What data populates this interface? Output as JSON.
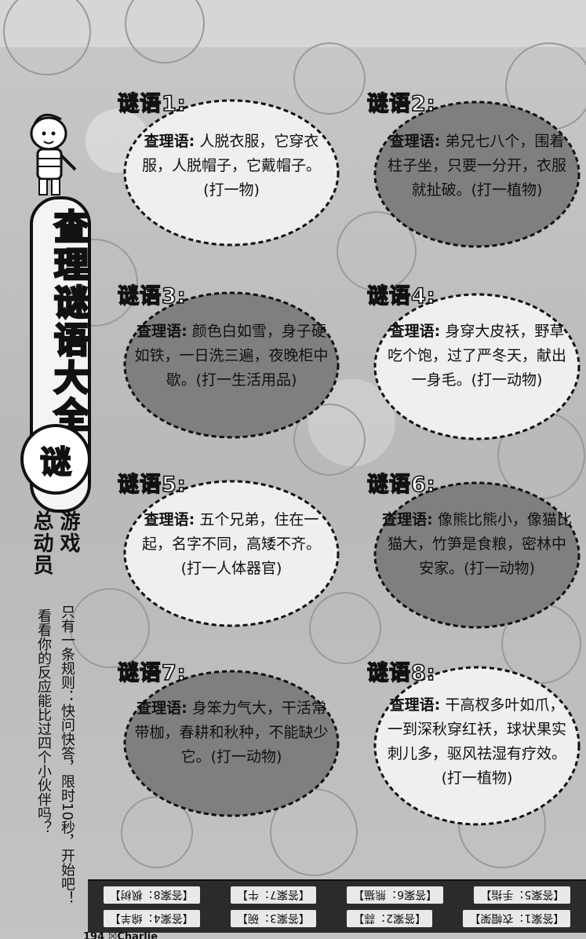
{
  "header": {
    "title_vertical": "查理谜语大全",
    "badge": "谜"
  },
  "sidebar": {
    "game_line1": "游戏",
    "game_line2": "总动员",
    "rules_line1": "只有一条规则：快问快答，限时10秒，开始吧！",
    "rules_line2": "看看你的反应能比过四个小伙伴吗？"
  },
  "riddles": [
    {
      "label": "谜语1:",
      "prefix": "查理语:",
      "text": "人脱衣服，它穿衣服，人脱帽子，它戴帽子。(打一物)"
    },
    {
      "label": "谜语2:",
      "prefix": "查理语:",
      "text": "弟兄七八个，围着柱子坐，只要一分开，衣服就扯破。(打一植物)"
    },
    {
      "label": "谜语3:",
      "prefix": "查理语:",
      "text": "颜色白如雪，身子硬如铁，一日洗三遍，夜晚柜中歇。(打一生活用品)"
    },
    {
      "label": "谜语4:",
      "prefix": "查理语:",
      "text": "身穿大皮袄，野草吃个饱，过了严冬天，献出一身毛。(打一动物)"
    },
    {
      "label": "谜语5:",
      "prefix": "查理语:",
      "text": "五个兄弟，住在一起，名字不同，高矮不齐。(打一人体器官)"
    },
    {
      "label": "谜语6:",
      "prefix": "查理语:",
      "text": "像熊比熊小，像猫比猫大，竹笋是食粮，密林中安家。(打一动物)"
    },
    {
      "label": "谜语7:",
      "prefix": "查理语:",
      "text": "身笨力气大，干活常带枷，春耕和秋种，不能缺少它。(打一动物)"
    },
    {
      "label": "谜语8:",
      "prefix": "查理语:",
      "text": "干高杈多叶如爪，一到深秋穿红袄，球状果实刺儿多，驱风祛湿有疗效。(打一植物)"
    }
  ],
  "answers": {
    "row1": [
      "【答案5：手指】",
      "【答案6：熊猫】",
      "【答案7：牛】",
      "【答案8：枫树】"
    ],
    "row2": [
      "【答案1：衣帽架】",
      "【答案2：蒜】",
      "【答案3：碗】",
      "【答案4：绵羊】"
    ]
  },
  "footer": {
    "page": "194 ☒Charlie"
  },
  "colors": {
    "card_dark": "#7f7f7f",
    "card_light": "#efefef",
    "outline": "#111111"
  }
}
